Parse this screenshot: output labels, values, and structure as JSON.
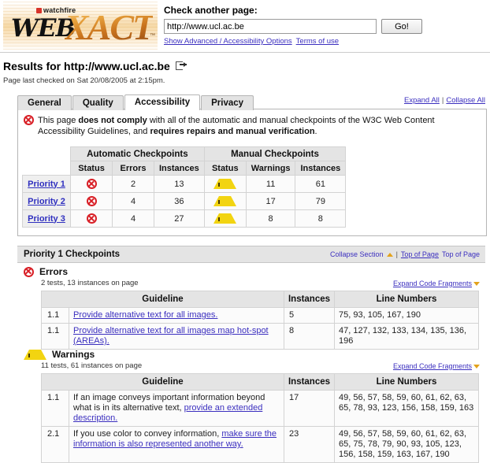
{
  "header": {
    "logo": {
      "watchfire": "watchfire",
      "web": "WEB",
      "xact": "XACT",
      "tm": "™"
    },
    "check_label": "Check another page:",
    "url_value": "http://www.ucl.ac.be",
    "url_placeholder": "http://",
    "go_label": "Go!",
    "link_advanced": "Show Advanced / Accessibility Options",
    "link_terms": "Terms of use"
  },
  "results": {
    "title": "Results for http://www.ucl.ac.be",
    "newwindow_icon": "open-in-new-window-icon",
    "last_checked": "Page last checked on Sat 20/08/2005 at 2:15pm."
  },
  "tabs": {
    "items": [
      {
        "label": "General",
        "active": false
      },
      {
        "label": "Quality",
        "active": false
      },
      {
        "label": "Accessibility",
        "active": true
      },
      {
        "label": "Privacy",
        "active": false
      }
    ],
    "expand_all": "Expand All",
    "collapse_all": "Collapse All",
    "separator": "|"
  },
  "notice": {
    "icon": "error-icon",
    "part1": "This page ",
    "bold1": "does not comply",
    "part2": " with all of the automatic and manual checkpoints of the W3C Web Content Accessibility Guidelines, and ",
    "bold2": "requires repairs and manual verification",
    "part3": "."
  },
  "summary": {
    "group_automatic": "Automatic Checkpoints",
    "group_manual": "Manual Checkpoints",
    "columns": [
      "Status",
      "Errors",
      "Instances",
      "Status",
      "Warnings",
      "Instances"
    ],
    "rows": [
      {
        "priority": "Priority 1",
        "auto_status": "error-icon",
        "errors": "2",
        "auto_instances": "13",
        "manual_status": "warning-icon",
        "warnings": "11",
        "manual_instances": "61"
      },
      {
        "priority": "Priority 2",
        "auto_status": "error-icon",
        "errors": "4",
        "auto_instances": "36",
        "manual_status": "warning-icon",
        "warnings": "17",
        "manual_instances": "79"
      },
      {
        "priority": "Priority 3",
        "auto_status": "error-icon",
        "errors": "4",
        "auto_instances": "27",
        "manual_status": "warning-icon",
        "warnings": "8",
        "manual_instances": "8"
      }
    ]
  },
  "section": {
    "title": "Priority 1 Checkpoints",
    "collapse_section": "Collapse Section",
    "separator": "|",
    "top_of_page_link": "Top of Page",
    "top_of_page_text": "Top of Page"
  },
  "errors_block": {
    "icon": "error-icon",
    "title": "Errors",
    "meta": "2 tests, 13 instances on page",
    "expand_fragments": "Expand Code Fragments",
    "columns": {
      "guideline": "Guideline",
      "instances": "Instances",
      "lines": "Line Numbers"
    },
    "rows": [
      {
        "num": "1.1",
        "guideline": "Provide alternative text for all images.",
        "instances": "5",
        "lines": "75, 93, 105, 167, 190"
      },
      {
        "num": "1.1",
        "guideline": "Provide alternative text for all images map hot-spot (AREAs).",
        "instances": "8",
        "lines": "47, 127, 132, 133, 134, 135, 136, 196"
      }
    ]
  },
  "warnings_block": {
    "icon": "warning-icon",
    "title": "Warnings",
    "meta": "11 tests, 61 instances on page",
    "expand_fragments": "Expand Code Fragments",
    "columns": {
      "guideline": "Guideline",
      "instances": "Instances",
      "lines": "Line Numbers"
    },
    "rows": [
      {
        "num": "1.1",
        "guideline_plain": "If an image conveys important information beyond what is in its alternative text, ",
        "guideline_link": "provide an extended description.",
        "instances": "17",
        "lines": "49, 56, 57, 58, 59, 60, 61, 62, 63, 65, 78, 93, 123, 156, 158, 159, 163"
      },
      {
        "num": "2.1",
        "guideline_plain": "If you use color to convey information, ",
        "guideline_link": "make sure the information is also represented another way.",
        "instances": "23",
        "lines": "49, 56, 57, 58, 59, 60, 61, 62, 63, 65, 75, 78, 79, 90, 93, 105, 123, 156, 158, 159, 163, 167, 190"
      }
    ]
  },
  "colors": {
    "link": "#3b2fbf",
    "error": "#d81f26",
    "warning": "#f2d411",
    "header_bg": "#e4e4e4",
    "accent_orange": "#e3a21b"
  }
}
